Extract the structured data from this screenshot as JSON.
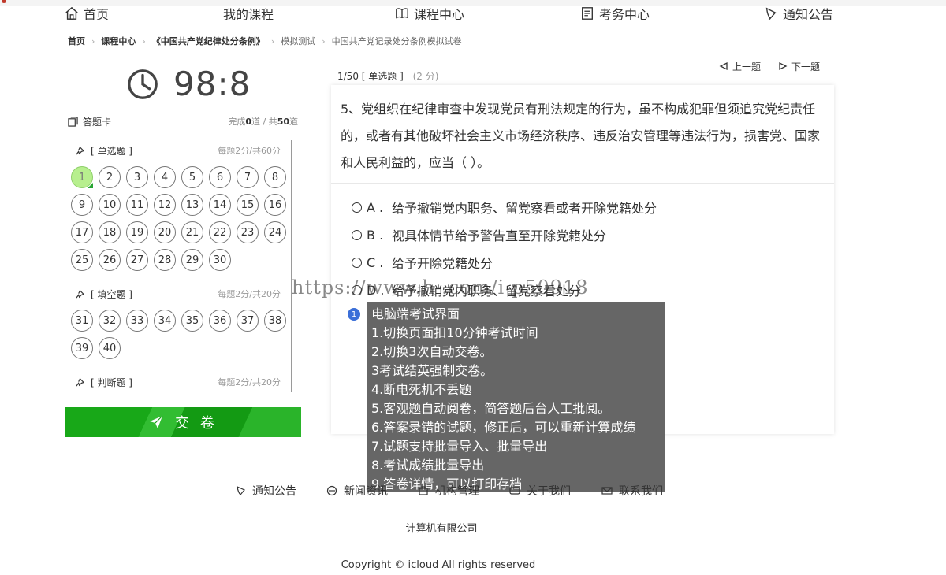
{
  "nav": {
    "home": "首页",
    "my_courses": "我的课程",
    "course_center": "课程中心",
    "exam_center": "考务中心",
    "notice": "通知公告"
  },
  "breadcrumb": [
    "首页",
    "课程中心",
    "《中国共产党纪律处分条例》",
    "模拟测试",
    "中国共产党记录处分条例模拟试卷"
  ],
  "timer": {
    "display": "98:8"
  },
  "answer_card": {
    "title": "答题卡",
    "done_prefix": "完成",
    "done_count": "0",
    "done_mid": "道 / 共",
    "total": "50",
    "done_suffix": "道",
    "sections": [
      {
        "name": "[ 单选题 ]",
        "rule": "每题2分/共60分",
        "numbers": [
          "1",
          "2",
          "3",
          "4",
          "5",
          "6",
          "7",
          "8",
          "9",
          "10",
          "11",
          "12",
          "13",
          "14",
          "15",
          "16",
          "17",
          "18",
          "19",
          "20",
          "21",
          "22",
          "23",
          "24",
          "25",
          "26",
          "27",
          "28",
          "29",
          "30"
        ],
        "current": "1"
      },
      {
        "name": "[ 填空题 ]",
        "rule": "每题2分/共20分",
        "numbers": [
          "31",
          "32",
          "33",
          "34",
          "35",
          "36",
          "37",
          "38",
          "39",
          "40"
        ]
      },
      {
        "name": "[ 判断题 ]",
        "rule": "每题2分/共20分",
        "numbers": []
      }
    ]
  },
  "submit": {
    "label": "交 卷"
  },
  "question": {
    "progress": "1/50",
    "type": "[ 单选题 ]",
    "score": "(2 分)",
    "prev": "上一题",
    "next": "下一题",
    "stem": "5、党组织在纪律审查中发现党员有刑法规定的行为，虽不构成犯罪但须追究党纪责任的，或者有其他破坏社会主义市场经济秩序、违反治安管理等违法行为，损害党、国家和人民利益的，应当（ ）。",
    "options": [
      {
        "key": "A .",
        "text": "给予撤销党内职务、留党察看或者开除党籍处分"
      },
      {
        "key": "B .",
        "text": "视具体情节给予警告直至开除党籍处分"
      },
      {
        "key": "C .",
        "text": "给予开除党籍处分"
      },
      {
        "key": "D .",
        "text": "给予撤销党内职务、留党察看处分"
      }
    ]
  },
  "watermark": "https://www.h                 .com/i      p50918",
  "tooltip": {
    "badge": "1",
    "lines": [
      "电脑端考试界面",
      "1.切换页面扣10分钟考试时间",
      "2.切换3次自动交卷。",
      "3考试结英强制交卷。",
      "4.断电死机不丢题",
      "5.客观题自动阅卷，简答题后台人工批阅。",
      "6.答案录错的试题，修正后，可以重新计算成绩",
      "7.试题支持批量导入、批量导出",
      "8.考试成绩批量导出",
      "9.答卷详情，可以打印存档"
    ]
  },
  "footer": {
    "links": [
      "通知公告",
      "新闻资讯",
      "机构管理",
      "关于我们",
      "联系我们"
    ],
    "company": "计算机有限公司",
    "copyright": "Copyright © icloud All rights reserved"
  }
}
